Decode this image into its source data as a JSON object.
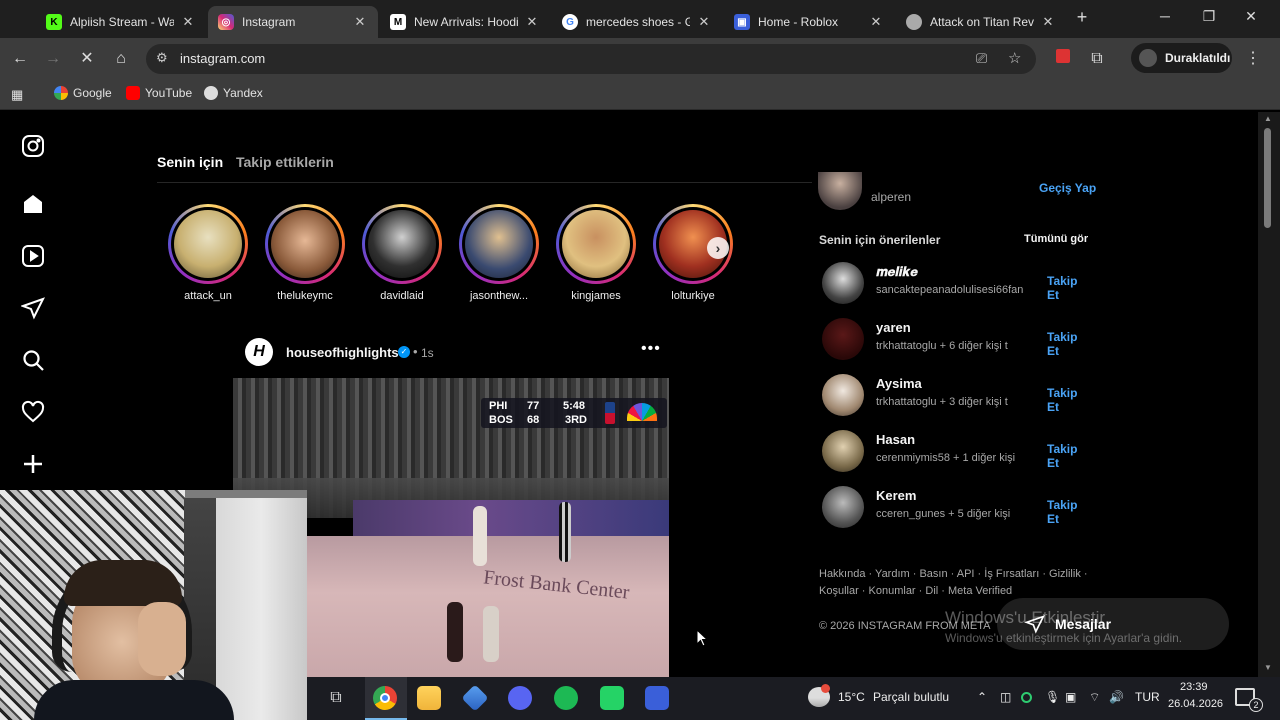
{
  "browser": {
    "tabs": [
      {
        "title": "Alpiish Stream - Watc",
        "icon": "kick-icon",
        "color": "#53fc18"
      },
      {
        "title": "Instagram",
        "icon": "instagram-icon",
        "color": "#e1306c"
      },
      {
        "title": "New Arrivals: Hoodie",
        "icon": "store-icon",
        "color": "#ffffff"
      },
      {
        "title": "mercedes shoes - Go",
        "icon": "google-icon",
        "color": "#4285f4"
      },
      {
        "title": "Home - Roblox",
        "icon": "roblox-icon",
        "color": "#3a5fd9"
      },
      {
        "title": "Attack on Titan Revol",
        "icon": "globe-icon",
        "color": "#888888"
      }
    ],
    "url": "instagram.com",
    "profile_label": "Duraklatıldı",
    "bookmarks": [
      {
        "label": "Google",
        "icon": "google-icon"
      },
      {
        "label": "YouTube",
        "icon": "youtube-icon"
      },
      {
        "label": "Yandex",
        "icon": "yandex-icon"
      }
    ]
  },
  "feed": {
    "tabs": [
      "Senin için",
      "Takip ettiklerin"
    ],
    "stories": [
      "attack_un",
      "thelukeymc",
      "davidlaid",
      "jasonthew...",
      "kingjames",
      "lolturkiye"
    ],
    "post": {
      "author": "houseofhighlights",
      "time": "1s",
      "score": {
        "home": "PHI",
        "home_score": "77",
        "away": "BOS",
        "away_score": "68",
        "clock": "5:48",
        "period": "3RD"
      },
      "court_text": "Frost Bank Center"
    }
  },
  "sidebar_right": {
    "current_user": {
      "username": "alperen",
      "switch_label": "Geçiş Yap"
    },
    "suggestions_title": "Senin için önerilenler",
    "see_all": "Tümünü gör",
    "follow_label": "Takip Et",
    "suggestions": [
      {
        "name": "𝒎𝒆𝒍𝒊𝒌𝒆",
        "sub": "sancaktepeanadolulisesi66fan",
        "color": "#d9d9d9"
      },
      {
        "name": "yaren",
        "sub": "trkhattatoglu + 6 diğer kişi t",
        "color": "#3a1010"
      },
      {
        "name": "Aysima",
        "sub": "trkhattatoglu + 3 diğer kişi t",
        "color": "#c9b9a0"
      },
      {
        "name": "Hasan",
        "sub": "cerenmiymis58 + 1 diğer kişi",
        "color": "#9c8a6a"
      },
      {
        "name": "Kerem",
        "sub": "cceren_gunes + 5 diğer kişi",
        "color": "#6a6a6a"
      }
    ],
    "footer_links_1": "Hakkında · Yardım · Basın · API · İş Fırsatları · Gizlilik ·",
    "footer_links_2": "Koşullar · Konumlar · Dil · Meta Verified",
    "copyright": "© 2026 INSTAGRAM FROM META"
  },
  "messages_label": "Mesajlar",
  "watermark": {
    "line1": "Windows'u Etkinleştir",
    "line2": "Windows'u etkinleştirmek için Ayarlar'a gidin."
  },
  "taskbar": {
    "weather": "15°C",
    "weather_desc": "Parçalı bulutlu",
    "lang": "TUR",
    "time": "23:39",
    "date": "26.04.2026",
    "notif_count": "2"
  }
}
